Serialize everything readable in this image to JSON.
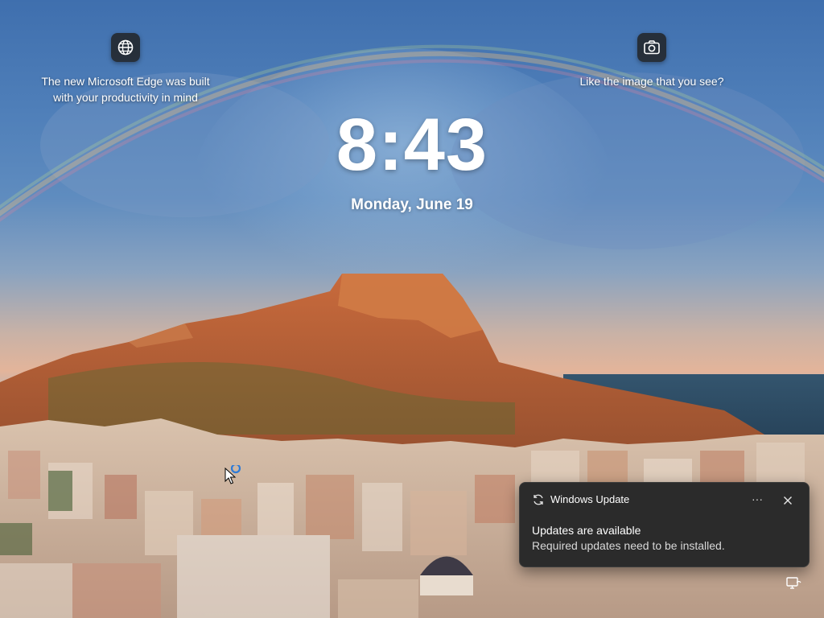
{
  "spotlight": {
    "left": {
      "icon": "globe-icon",
      "line1": "The new Microsoft Edge was built",
      "line2": "with your productivity in mind"
    },
    "right": {
      "icon": "camera-icon",
      "text": "Like the image that you see?"
    }
  },
  "lockscreen": {
    "time": "8:43",
    "date": "Monday, June 19"
  },
  "toast": {
    "app_icon": "sync-icon",
    "app_name": "Windows Update",
    "more_label": "···",
    "close_icon": "close-icon",
    "title": "Updates are available",
    "body": "Required updates need to be installed."
  },
  "status": {
    "network_icon": "network-icon"
  },
  "colors": {
    "toast_background": "#2b2b2b",
    "text": "#ffffff",
    "icon_button_background": "#202020"
  }
}
